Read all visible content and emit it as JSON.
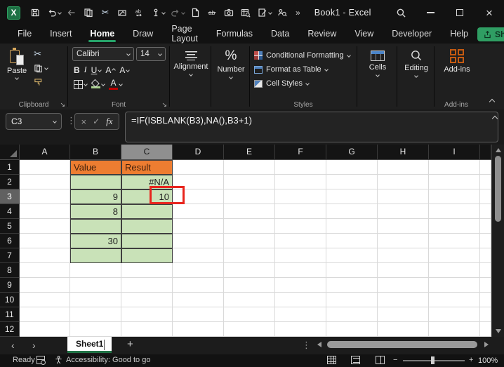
{
  "titlebar": {
    "title": "Book1 - Excel"
  },
  "ribbon_tabs": {
    "items": [
      "File",
      "Insert",
      "Home",
      "Draw",
      "Page Layout",
      "Formulas",
      "Data",
      "Review",
      "View",
      "Developer",
      "Help"
    ],
    "active": "Home"
  },
  "share": {
    "label": "Share"
  },
  "ribbon": {
    "clipboard": {
      "group_label": "Clipboard",
      "paste_label": "Paste"
    },
    "font": {
      "group_label": "Font",
      "font_name": "Calibri",
      "font_size": "14",
      "bold": "B",
      "italic": "I",
      "underline": "U",
      "grow_label": "A",
      "shrink_label": "A",
      "font_color_label": "A"
    },
    "alignment": {
      "button_label": "Alignment"
    },
    "number": {
      "button_label": "Number",
      "icon_label": "%"
    },
    "styles": {
      "group_label": "Styles",
      "conditional_formatting": "Conditional Formatting",
      "format_as_table": "Format as Table",
      "cell_styles": "Cell Styles"
    },
    "cells": {
      "button_label": "Cells"
    },
    "editing": {
      "button_label": "Editing"
    },
    "addins": {
      "group_label": "Add-ins",
      "button_label": "Add-ins"
    }
  },
  "formula_bar": {
    "name_box": "C3",
    "fx_label": "fx",
    "formula": "=IF(ISBLANK(B3),NA(),B3+1)"
  },
  "grid": {
    "column_headers": [
      "A",
      "B",
      "C",
      "D",
      "E",
      "F",
      "G",
      "H",
      "I"
    ],
    "row_headers": [
      "1",
      "2",
      "3",
      "4",
      "5",
      "6",
      "7",
      "8",
      "9",
      "10",
      "11",
      "12"
    ],
    "selected_column": "C",
    "selected_row": "3",
    "cells": {
      "B1": "Value",
      "C1": "Result",
      "C2": "#N/A",
      "B3": "9",
      "C3": "10",
      "B4": "8",
      "B6": "30"
    },
    "orange_cells": [
      "B1",
      "C1"
    ],
    "green_range": {
      "cols": [
        "B",
        "C"
      ],
      "rows": [
        2,
        3,
        4,
        5,
        6,
        7
      ]
    },
    "annotated_cell": "C3",
    "colors": {
      "header_fill": "#ED7D31",
      "header_text": "#42210B",
      "data_fill": "#C9E2B8",
      "annotation_border": "#E8251D",
      "accent_green": "#26A269",
      "share_green": "#2F9E63"
    }
  },
  "sheet_bar": {
    "active_tab": "Sheet1",
    "add_label": "+"
  },
  "status_bar": {
    "mode": "Ready",
    "accessibility": "Accessibility: Good to go",
    "zoom_level": "100%"
  }
}
